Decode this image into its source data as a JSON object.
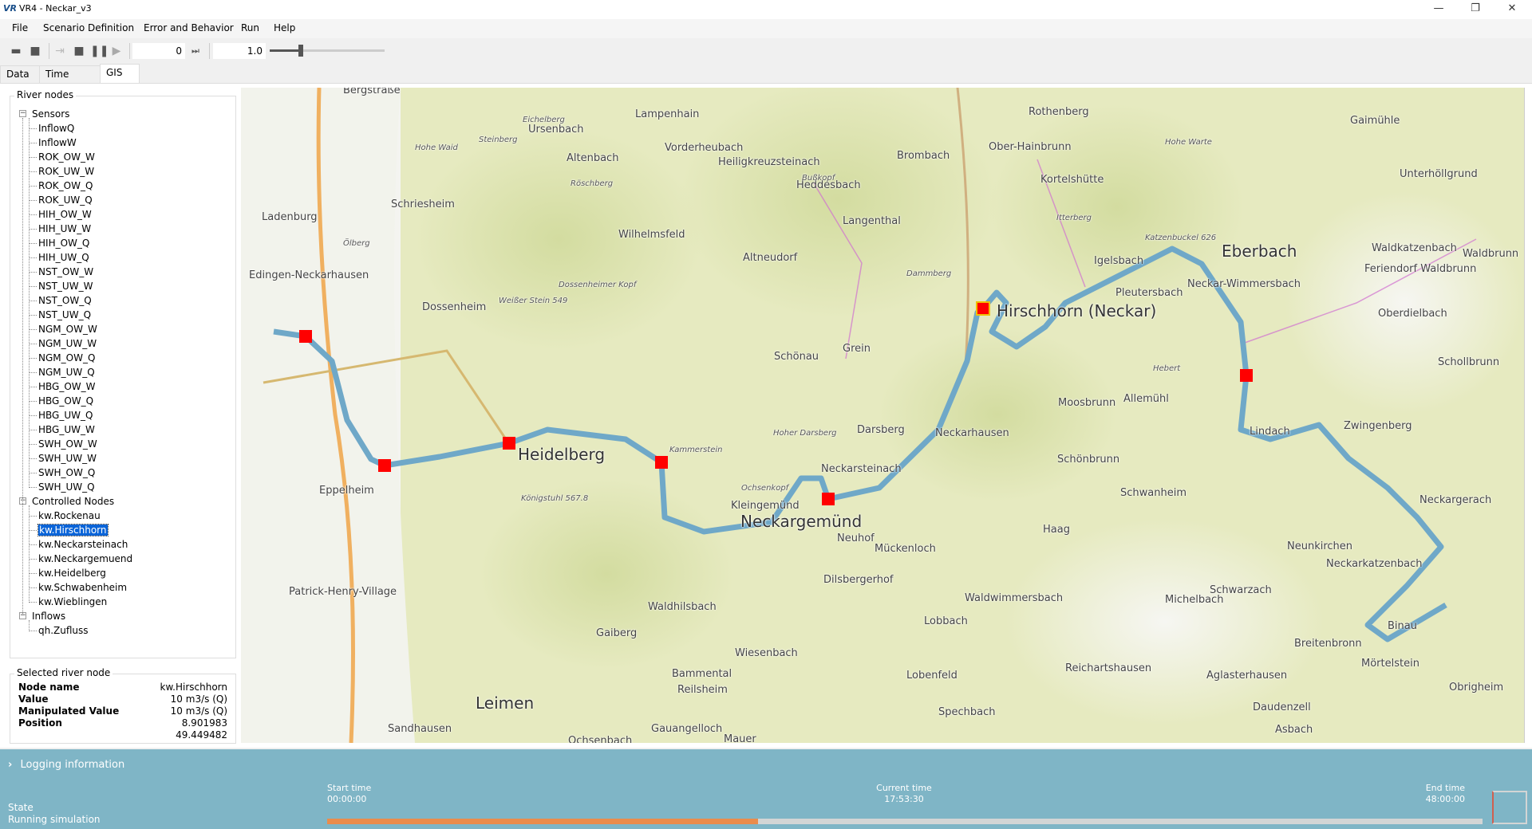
{
  "window": {
    "logo": "VR",
    "title": "VR4 - Neckar_v3"
  },
  "menu": [
    "File",
    "Scenario Definition",
    "Error and Behavior",
    "Run",
    "Help"
  ],
  "toolbar": {
    "step_value": "0",
    "speed_value": "1.0",
    "speed_slider_fraction": 0.27
  },
  "tabs": [
    {
      "label": "Data"
    },
    {
      "label": "Time Series"
    },
    {
      "label": "GIS",
      "active": true
    }
  ],
  "tree": {
    "title": "River nodes",
    "groups": [
      {
        "label": "Sensors",
        "items": [
          "InflowQ",
          "InflowW",
          "ROK_OW_W",
          "ROK_UW_W",
          "ROK_OW_Q",
          "ROK_UW_Q",
          "HIH_OW_W",
          "HIH_UW_W",
          "HIH_OW_Q",
          "HIH_UW_Q",
          "NST_OW_W",
          "NST_UW_W",
          "NST_OW_Q",
          "NST_UW_Q",
          "NGM_OW_W",
          "NGM_UW_W",
          "NGM_OW_Q",
          "NGM_UW_Q",
          "HBG_OW_W",
          "HBG_OW_Q",
          "HBG_UW_Q",
          "HBG_UW_W",
          "SWH_OW_W",
          "SWH_UW_W",
          "SWH_OW_Q",
          "SWH_UW_Q"
        ]
      },
      {
        "label": "Controlled Nodes",
        "items": [
          "kw.Rockenau",
          "kw.Hirschhorn",
          "kw.Neckarsteinach",
          "kw.Neckargemuend",
          "kw.Heidelberg",
          "kw.Schwabenheim",
          "kw.Wieblingen"
        ],
        "selected": "kw.Hirschhorn"
      },
      {
        "label": "Inflows",
        "items": [
          "qh.Zufluss"
        ]
      }
    ]
  },
  "selected_node": {
    "title": "Selected river node",
    "rows": [
      {
        "label": "Node name",
        "value": "kw.Hirschhorn"
      },
      {
        "label": "Value",
        "value": "10 m3/s (Q)"
      },
      {
        "label": "Manipulated Value",
        "value": "10 m3/s (Q)"
      },
      {
        "label": "Position",
        "value": "8.901983"
      },
      {
        "label": "",
        "value": "49.449482"
      }
    ]
  },
  "map": {
    "colors": {
      "river": "#6fa8c8",
      "marker": "#ff0000",
      "selected_marker_border": "#f0c000",
      "forest": "#e6eac0",
      "urban": "#f4f4f0"
    },
    "labels": [
      "Heidelberg",
      "Neckargemünd",
      "Leimen",
      "Schriesheim",
      "Ladenburg",
      "Edingen-Neckarhausen",
      "Dossenheim",
      "Eppelheim",
      "Wilhelmsfeld",
      "Altenbach",
      "Ursenbach",
      "Lampenhain",
      "Vorderheubach",
      "Heiligkreuzsteinach",
      "Heddesbach",
      "Langenthal",
      "Altneudorf",
      "Schönau",
      "Grein",
      "Brombach",
      "Ober-Hainbrunn",
      "Rothenberg",
      "Kortelshütte",
      "Hirschhorn (Neckar)",
      "Eberbach",
      "Igelsbach",
      "Pleutersbach",
      "Neckar-Wimmersbach",
      "Gaimühle",
      "Unterhöllgrund",
      "Waldkatzenbach",
      "Waldbrunn",
      "Feriendorf Waldbrunn",
      "Oberdielbach",
      "Schollbrunn",
      "Zwingenberg",
      "Lindach",
      "Neckargerach",
      "Neckarkatzenbach",
      "Neunkirchen",
      "Schwarzach",
      "Michelbach",
      "Binau",
      "Breitenbronn",
      "Mörtelstein",
      "Obrigheim",
      "Reichartshausen",
      "Aglasterhausen",
      "Daudenzell",
      "Asbach",
      "Schönbrunn",
      "Moosbrunn",
      "Allemühl",
      "Schwanheim",
      "Haag",
      "Neckarhausen",
      "Neckarsteinach",
      "Darsberg",
      "Kleingemünd",
      "Neuhof",
      "Mückenloch",
      "Dilsbergerhof",
      "Waldwimmersbach",
      "Lobbach",
      "Lobenfeld",
      "Spechbach",
      "Wiesenbach",
      "Bammental",
      "Reilsheim",
      "Waldhilsbach",
      "Gaiberg",
      "Sandhausen",
      "Patrick-Henry-Village",
      "Mauer",
      "Gauangelloch",
      "Ochsenbach",
      "Bergstraße"
    ],
    "peaks": [
      "Hohe Waid",
      "Steinberg",
      "Eichelberg",
      "Röschberg",
      "Ölberg",
      "Weißer Stein 549",
      "Dossenheimer Kopf",
      "Bußkopf",
      "Dammberg",
      "Itterberg",
      "Hohe Warte",
      "Katzenbuckel 626",
      "Hebert",
      "Hoher Darsberg",
      "Ochsenkopf",
      "Kammerstein",
      "Königstuhl 567.8"
    ]
  },
  "bottom": {
    "logging_label": "Logging information",
    "state_label": "State",
    "state_value": "Running simulation",
    "start_label": "Start time",
    "start_value": "00:00:00",
    "current_label": "Current time",
    "current_value": "17:53:30",
    "end_label": "End time",
    "end_value": "48:00:00",
    "progress_fraction": 0.3727
  }
}
